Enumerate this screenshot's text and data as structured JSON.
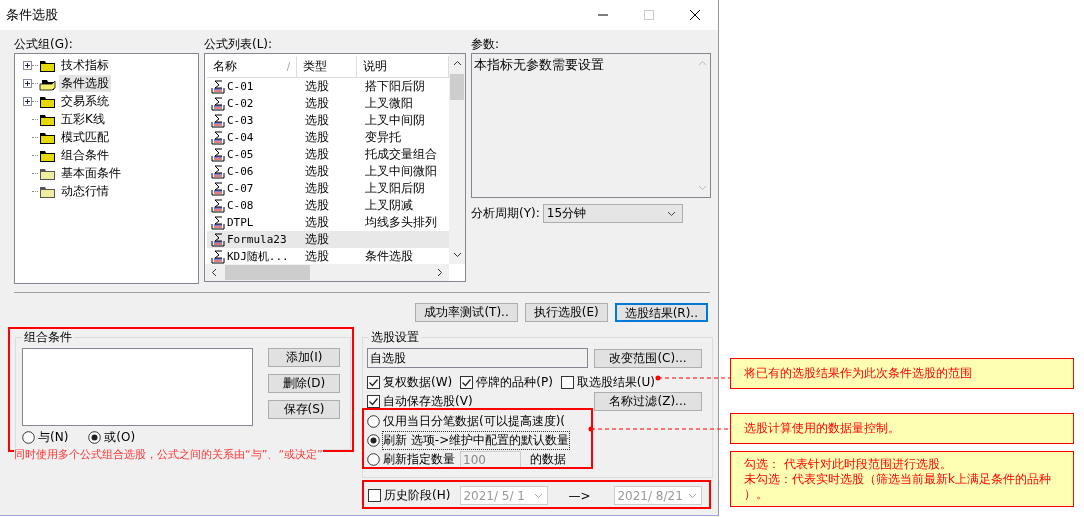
{
  "window": {
    "title": "条件选股"
  },
  "formula_group": {
    "label": "公式组(G):",
    "tree": [
      {
        "label": "技术指标",
        "kind": "folder",
        "expandable": true,
        "selected": false
      },
      {
        "label": "条件选股",
        "kind": "open-folder",
        "expandable": true,
        "selected": true
      },
      {
        "label": "交易系统",
        "kind": "folder",
        "expandable": true,
        "selected": false
      },
      {
        "label": "五彩K线",
        "kind": "folder",
        "expandable": false,
        "selected": false
      },
      {
        "label": "模式匹配",
        "kind": "folder",
        "expandable": false,
        "selected": false
      },
      {
        "label": "组合条件",
        "kind": "folder",
        "expandable": false,
        "selected": false
      },
      {
        "label": "基本面条件",
        "kind": "light-folder",
        "expandable": false,
        "selected": false
      },
      {
        "label": "动态行情",
        "kind": "light-folder",
        "expandable": false,
        "selected": false
      }
    ]
  },
  "formula_list": {
    "label": "公式列表(L):",
    "columns": [
      {
        "label": "名称",
        "sort_mark": "/"
      },
      {
        "label": "类型"
      },
      {
        "label": "说明"
      }
    ],
    "rows": [
      {
        "name": "C-01",
        "type": "选股",
        "description": "搭下阳后阴",
        "selected": false
      },
      {
        "name": "C-02",
        "type": "选股",
        "description": "上叉微阳",
        "selected": false
      },
      {
        "name": "C-03",
        "type": "选股",
        "description": "上叉中间阴",
        "selected": false
      },
      {
        "name": "C-04",
        "type": "选股",
        "description": "变异托",
        "selected": false
      },
      {
        "name": "C-05",
        "type": "选股",
        "description": "托成交量组合",
        "selected": false
      },
      {
        "name": "C-06",
        "type": "选股",
        "description": "上叉中间微阳",
        "selected": false
      },
      {
        "name": "C-07",
        "type": "选股",
        "description": "上叉阳后阴",
        "selected": false
      },
      {
        "name": "C-08",
        "type": "选股",
        "description": "上叉阴减",
        "selected": false
      },
      {
        "name": "DTPL",
        "type": "选股",
        "description": "均线多头排列",
        "selected": false
      },
      {
        "name": "Formula23",
        "type": "选股",
        "selected": true
      },
      {
        "name": "KDJ随机...",
        "type": "选股",
        "description": "条件选股",
        "selected": false
      }
    ]
  },
  "parameters": {
    "label": "参数:",
    "text": "本指标无参数需要设置"
  },
  "period": {
    "label": "分析周期(Y):",
    "value": "15分钟"
  },
  "action_buttons": [
    {
      "label": "成功率测试(T)..",
      "default": false
    },
    {
      "label": "执行选股(E)",
      "default": false
    },
    {
      "label": "选股结果(R)..",
      "default": true
    }
  ],
  "combination": {
    "title": "组合条件",
    "buttons": [
      "添加(I)",
      "删除(D)",
      "保存(S)"
    ],
    "radios": [
      {
        "label": "与(N)",
        "selected": false
      },
      {
        "label": "或(O)",
        "selected": true
      }
    ]
  },
  "settings": {
    "title": "选股设置",
    "range_value": "自选股",
    "range_button": "改变范围(C)...",
    "filter_button": "名称过滤(Z)...",
    "checkboxes": [
      {
        "label": "复权数据(W)",
        "checked": true
      },
      {
        "label": "停牌的品种(P)",
        "checked": true
      },
      {
        "label": "取选股结果(U)",
        "checked": false
      },
      {
        "label": "自动保存选股(V)",
        "checked": true
      }
    ],
    "data_radios": [
      {
        "label": "仅用当日分笔数据(可以提高速度)(",
        "selected": false
      },
      {
        "label": "刷新 选项->维护中配置的默认数量",
        "selected": true
      },
      {
        "label": "刷新指定数量",
        "value": "100",
        "suffix": "的数据",
        "selected": false
      }
    ],
    "history": {
      "label": "历史阶段(H)",
      "checked": false,
      "from": "2021/ 5/ 1",
      "arrow": "—>",
      "to": "2021/ 8/21"
    }
  },
  "annotations": {
    "caption": "同时使用多个公式组合选股，公式之间的关系由“与”、“或决定”",
    "callouts": [
      {
        "lines": [
          "将已有的选股结果作为此次条件选股的范围"
        ]
      },
      {
        "lines": [
          "选股计算使用的数据量控制。"
        ]
      },
      {
        "lines": [
          "勾选： 代表针对此时段范围进行选股。",
          "未勾选：代表实时选股（筛选当前最新k上满足条件的品种",
          "）。"
        ]
      }
    ]
  }
}
